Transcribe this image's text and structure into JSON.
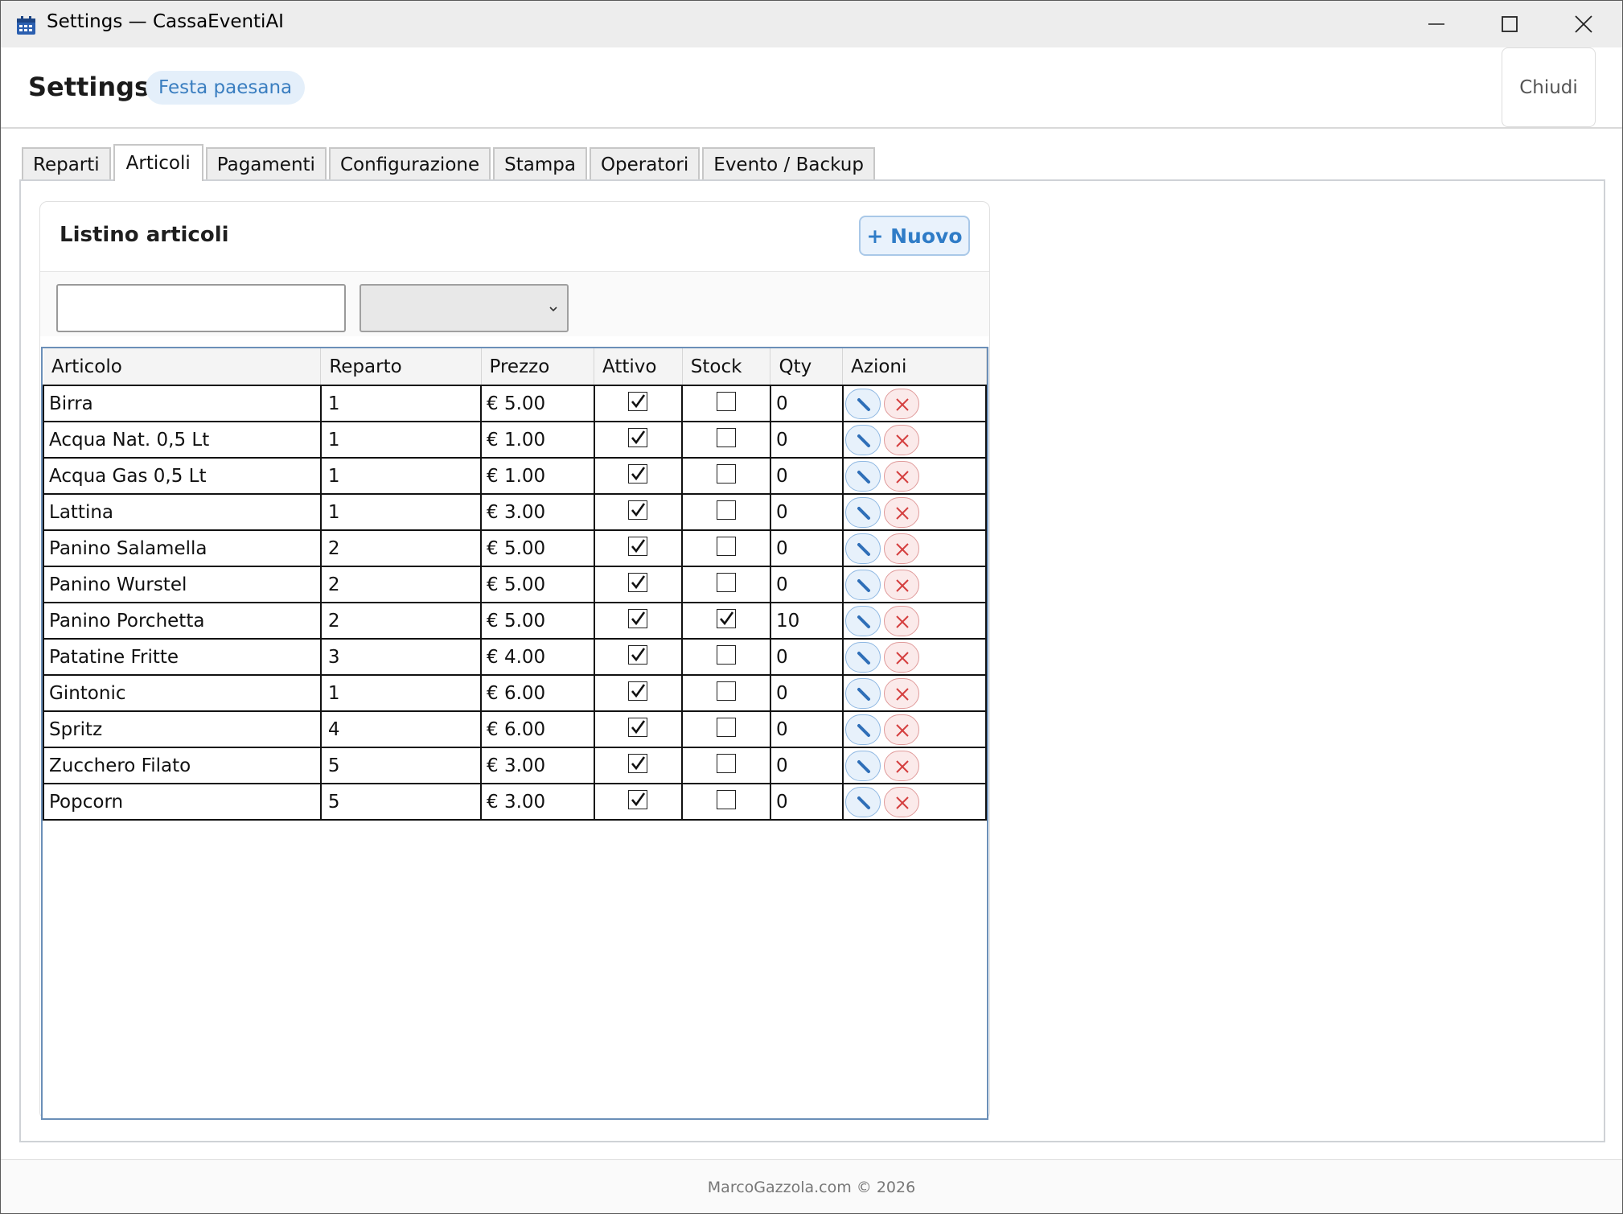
{
  "window": {
    "title": "Settings — CassaEventiAI",
    "minimize_icon": "minimize-icon",
    "maximize_icon": "maximize-icon",
    "close_icon": "close-icon"
  },
  "header": {
    "title": "Settings",
    "event_badge": "Festa paesana",
    "close_label": "Chiudi"
  },
  "tabs": [
    {
      "label": "Reparti",
      "active": false
    },
    {
      "label": "Articoli",
      "active": true
    },
    {
      "label": "Pagamenti",
      "active": false
    },
    {
      "label": "Configurazione",
      "active": false
    },
    {
      "label": "Stampa",
      "active": false
    },
    {
      "label": "Operatori",
      "active": false
    },
    {
      "label": "Evento / Backup",
      "active": false
    }
  ],
  "articoli": {
    "title": "Listino articoli",
    "new_button": "+ Nuovo",
    "search": {
      "value": "",
      "placeholder": ""
    },
    "filter_select": {
      "value": ""
    },
    "columns": [
      "Articolo",
      "Reparto",
      "Prezzo",
      "Attivo",
      "Stock",
      "Qty",
      "Azioni"
    ],
    "rows": [
      {
        "articolo": "Birra",
        "reparto": "1",
        "prezzo": "€ 5.00",
        "attivo": true,
        "stock": false,
        "qty": "0"
      },
      {
        "articolo": "Acqua Nat. 0,5 Lt",
        "reparto": "1",
        "prezzo": "€ 1.00",
        "attivo": true,
        "stock": false,
        "qty": "0"
      },
      {
        "articolo": "Acqua Gas 0,5 Lt",
        "reparto": "1",
        "prezzo": "€ 1.00",
        "attivo": true,
        "stock": false,
        "qty": "0"
      },
      {
        "articolo": "Lattina",
        "reparto": "1",
        "prezzo": "€ 3.00",
        "attivo": true,
        "stock": false,
        "qty": "0"
      },
      {
        "articolo": "Panino Salamella",
        "reparto": "2",
        "prezzo": "€ 5.00",
        "attivo": true,
        "stock": false,
        "qty": "0"
      },
      {
        "articolo": "Panino Wurstel",
        "reparto": "2",
        "prezzo": "€ 5.00",
        "attivo": true,
        "stock": false,
        "qty": "0"
      },
      {
        "articolo": "Panino Porchetta",
        "reparto": "2",
        "prezzo": "€ 5.00",
        "attivo": true,
        "stock": true,
        "qty": "10"
      },
      {
        "articolo": "Patatine Fritte",
        "reparto": "3",
        "prezzo": "€ 4.00",
        "attivo": true,
        "stock": false,
        "qty": "0"
      },
      {
        "articolo": "Gintonic",
        "reparto": "1",
        "prezzo": "€ 6.00",
        "attivo": true,
        "stock": false,
        "qty": "0"
      },
      {
        "articolo": "Spritz",
        "reparto": "4",
        "prezzo": "€ 6.00",
        "attivo": true,
        "stock": false,
        "qty": "0"
      },
      {
        "articolo": "Zucchero Filato",
        "reparto": "5",
        "prezzo": "€ 3.00",
        "attivo": true,
        "stock": false,
        "qty": "0"
      },
      {
        "articolo": "Popcorn",
        "reparto": "5",
        "prezzo": "€ 3.00",
        "attivo": true,
        "stock": false,
        "qty": "0"
      }
    ],
    "row_actions": {
      "edit_icon": "pencil-icon",
      "delete_icon": "close-icon"
    }
  },
  "footer": {
    "text": "MarcoGazzola.com © 2026"
  },
  "colors": {
    "accent": "#2f7cc7",
    "badge_bg": "#e4effa",
    "delete": "#d9534f"
  }
}
